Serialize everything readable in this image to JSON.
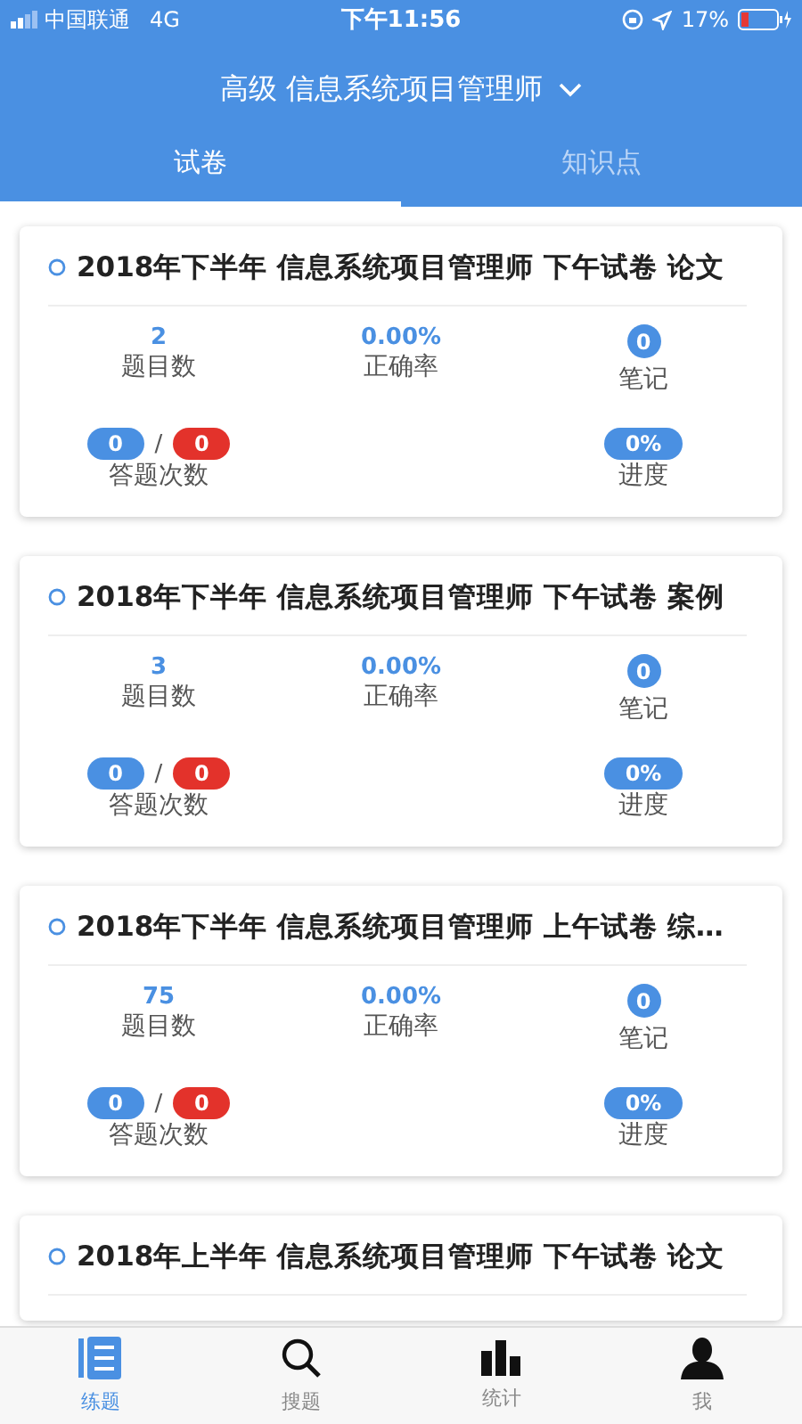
{
  "status_bar": {
    "carrier": "中国联通",
    "network": "4G",
    "time": "下午11:56",
    "battery": "17%"
  },
  "header": {
    "title": "高级 信息系统项目管理师"
  },
  "tabs": [
    {
      "label": "试卷",
      "selected": true
    },
    {
      "label": "知识点",
      "selected": false
    }
  ],
  "papers": [
    {
      "title": "2018年下半年 信息系统项目管理师 下午试卷 论文",
      "question_count": "2",
      "question_count_label": "题目数",
      "accuracy": "0.00%",
      "accuracy_label": "正确率",
      "notes": "0",
      "notes_label": "笔记",
      "answered": "0",
      "separator": "/",
      "wrong": "0",
      "attempts_label": "答题次数",
      "progress": "0%",
      "progress_label": "进度"
    },
    {
      "title": "2018年下半年 信息系统项目管理师 下午试卷 案例",
      "question_count": "3",
      "question_count_label": "题目数",
      "accuracy": "0.00%",
      "accuracy_label": "正确率",
      "notes": "0",
      "notes_label": "笔记",
      "answered": "0",
      "separator": "/",
      "wrong": "0",
      "attempts_label": "答题次数",
      "progress": "0%",
      "progress_label": "进度"
    },
    {
      "title": "2018年下半年 信息系统项目管理师 上午试卷 综…",
      "question_count": "75",
      "question_count_label": "题目数",
      "accuracy": "0.00%",
      "accuracy_label": "正确率",
      "notes": "0",
      "notes_label": "笔记",
      "answered": "0",
      "separator": "/",
      "wrong": "0",
      "attempts_label": "答题次数",
      "progress": "0%",
      "progress_label": "进度"
    },
    {
      "title": "2018年上半年 信息系统项目管理师 下午试卷 论文"
    }
  ],
  "bottom_nav": [
    {
      "label": "练题",
      "kind": "list",
      "selected": true
    },
    {
      "label": "搜题",
      "kind": "search",
      "selected": false
    },
    {
      "label": "统计",
      "kind": "chart",
      "selected": false
    },
    {
      "label": "我",
      "kind": "person",
      "selected": false
    }
  ]
}
